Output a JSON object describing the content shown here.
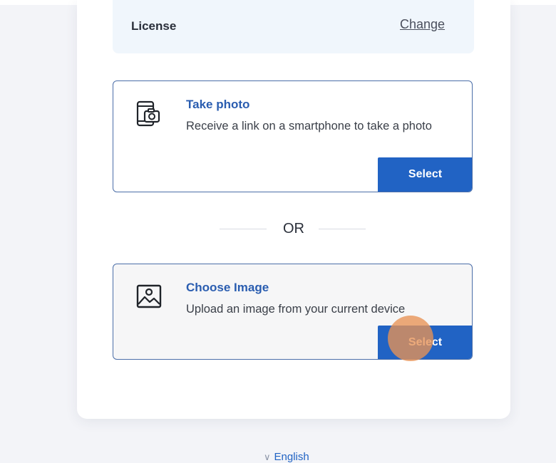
{
  "license": {
    "label": "License",
    "change_label": "Change"
  },
  "options": [
    {
      "title": "Take photo",
      "description": "Receive a link on a smartphone to take a photo",
      "button_label": "Select",
      "icon": "smartphone-camera-icon"
    },
    {
      "title": "Choose Image",
      "description": "Upload an image from your current device",
      "button_label": "Select",
      "icon": "image-icon"
    }
  ],
  "divider": {
    "label": "OR"
  },
  "language": {
    "label": "English",
    "icon": "chevron-down-icon"
  },
  "colors": {
    "accent": "#2163c4",
    "title": "#2a5db0",
    "border": "#4b6ea8",
    "license_bg": "#f0f6fc",
    "page_bg": "#f3f4f8",
    "cursor_highlight": "#e89254"
  }
}
